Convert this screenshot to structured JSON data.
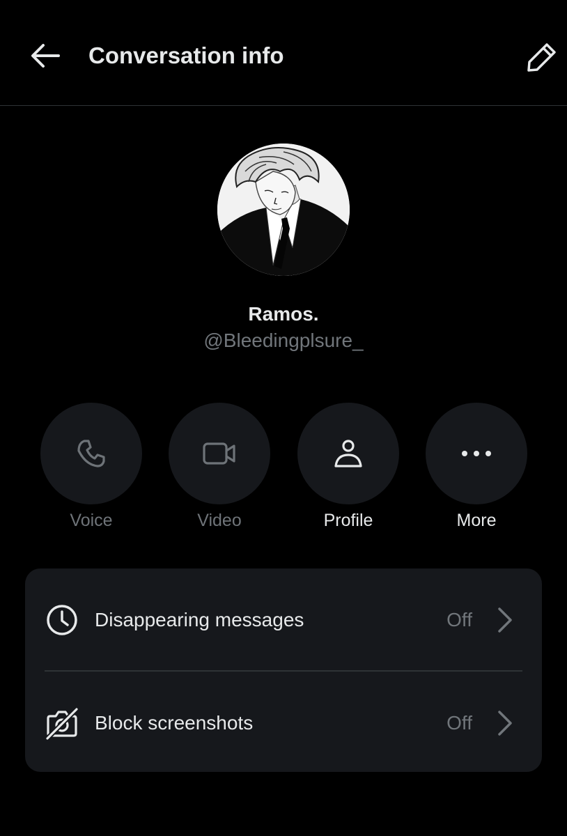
{
  "header": {
    "title": "Conversation info",
    "back_icon": "arrow-left-icon",
    "edit_icon": "pencil-icon"
  },
  "profile": {
    "display_name": "Ramos.",
    "handle": "@Bleedingplsure_",
    "avatar_icon": "illustrated-avatar"
  },
  "actions": [
    {
      "label": "Voice",
      "icon": "phone-icon",
      "enabled": false
    },
    {
      "label": "Video",
      "icon": "video-camera-icon",
      "enabled": false
    },
    {
      "label": "Profile",
      "icon": "person-icon",
      "enabled": true
    },
    {
      "label": "More",
      "icon": "more-dots-icon",
      "enabled": true
    }
  ],
  "settings": [
    {
      "label": "Disappearing messages",
      "value": "Off",
      "icon": "clock-icon"
    },
    {
      "label": "Block screenshots",
      "value": "Off",
      "icon": "camera-off-icon"
    }
  ],
  "colors": {
    "background": "#000000",
    "surface": "#16181c",
    "text_primary": "#e7e9ea",
    "text_secondary": "#71767b",
    "divider": "#2f3336"
  }
}
